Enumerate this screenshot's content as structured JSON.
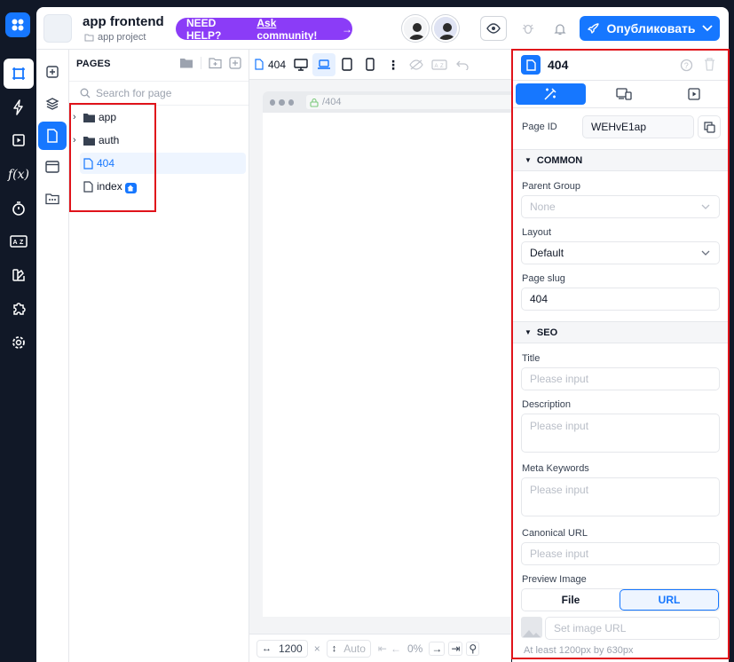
{
  "header": {
    "project_name": "app frontend",
    "project_sub": "app project",
    "help_label": "NEED HELP?",
    "help_link": "Ask community!",
    "publish_label": "Опубликовать"
  },
  "pages_panel": {
    "title": "PAGES",
    "search_placeholder": "Search for page",
    "items": [
      {
        "label": "app",
        "type": "folder"
      },
      {
        "label": "auth",
        "type": "folder"
      },
      {
        "label": "404",
        "type": "page",
        "selected": true
      },
      {
        "label": "index",
        "type": "page",
        "home": true
      }
    ]
  },
  "canvas": {
    "page_name": "404",
    "url_path": "/404",
    "width_value": "1200",
    "height_value": "Auto",
    "zoom_value": "0%"
  },
  "props": {
    "title": "404",
    "page_id_label": "Page ID",
    "page_id_value": "WEHvE1ap",
    "common_section": "COMMON",
    "parent_group_label": "Parent Group",
    "parent_group_value": "None",
    "layout_label": "Layout",
    "layout_value": "Default",
    "page_slug_label": "Page slug",
    "page_slug_value": "404",
    "seo_section": "SEO",
    "title_label": "Title",
    "title_placeholder": "Please input",
    "description_label": "Description",
    "description_placeholder": "Please input",
    "meta_keywords_label": "Meta Keywords",
    "meta_keywords_placeholder": "Please input",
    "canonical_label": "Canonical URL",
    "canonical_placeholder": "Please input",
    "preview_image_label": "Preview Image",
    "file_option": "File",
    "url_option": "URL",
    "image_url_placeholder": "Set image URL",
    "image_hint": "At least 1200px by 630px"
  },
  "colors": {
    "accent": "#1677ff",
    "help_pill": "#8b3cf7",
    "highlight": "#e0131a",
    "rail": "#111827"
  }
}
